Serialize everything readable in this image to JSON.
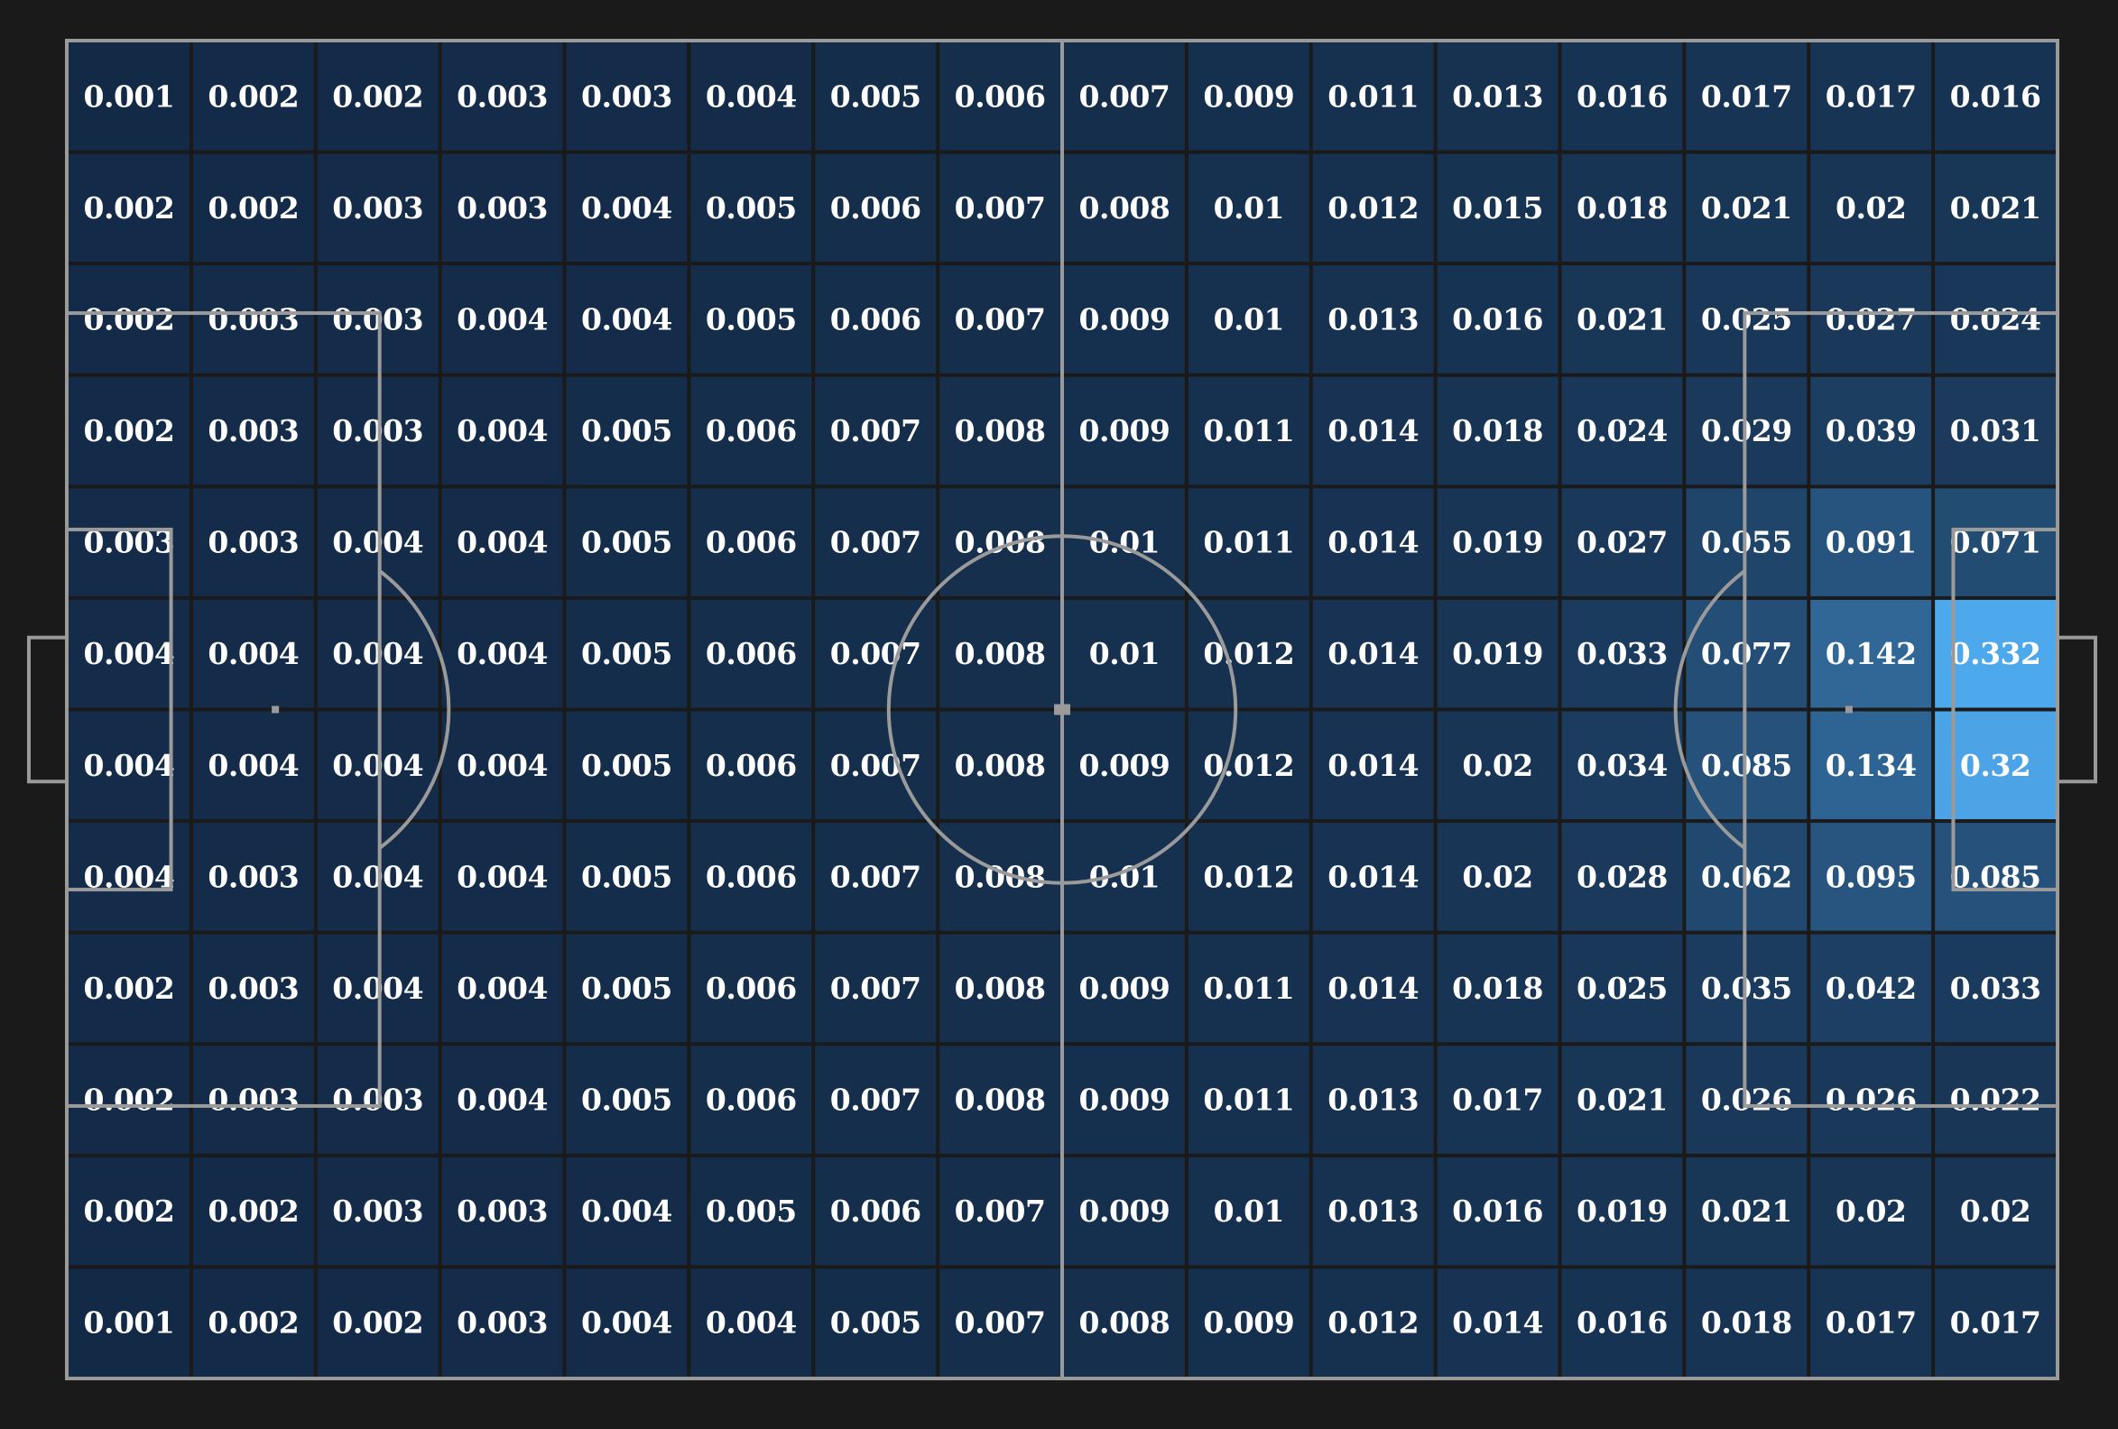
{
  "chart_data": {
    "type": "heatmap",
    "description_free": true,
    "rows": 12,
    "cols": 16,
    "value_range": [
      0.001,
      0.332
    ],
    "colors": {
      "background": "#1a1a1a",
      "cell_min": "#132a47",
      "cell_max": "#4ea8ec",
      "lines": "#9a9a9a",
      "text": "#ffffff"
    },
    "values": [
      [
        0.001,
        0.002,
        0.002,
        0.003,
        0.003,
        0.004,
        0.005,
        0.006,
        0.007,
        0.009,
        0.011,
        0.013,
        0.016,
        0.017,
        0.017,
        0.016
      ],
      [
        0.002,
        0.002,
        0.003,
        0.003,
        0.004,
        0.005,
        0.006,
        0.007,
        0.008,
        0.01,
        0.012,
        0.015,
        0.018,
        0.021,
        0.02,
        0.021
      ],
      [
        0.002,
        0.003,
        0.003,
        0.004,
        0.004,
        0.005,
        0.006,
        0.007,
        0.009,
        0.01,
        0.013,
        0.016,
        0.021,
        0.025,
        0.027,
        0.024
      ],
      [
        0.002,
        0.003,
        0.003,
        0.004,
        0.005,
        0.006,
        0.007,
        0.008,
        0.009,
        0.011,
        0.014,
        0.018,
        0.024,
        0.029,
        0.039,
        0.031
      ],
      [
        0.003,
        0.003,
        0.004,
        0.004,
        0.005,
        0.006,
        0.007,
        0.008,
        0.01,
        0.011,
        0.014,
        0.019,
        0.027,
        0.055,
        0.091,
        0.071
      ],
      [
        0.004,
        0.004,
        0.004,
        0.004,
        0.005,
        0.006,
        0.007,
        0.008,
        0.01,
        0.012,
        0.014,
        0.019,
        0.033,
        0.077,
        0.142,
        0.332
      ],
      [
        0.004,
        0.004,
        0.004,
        0.004,
        0.005,
        0.006,
        0.007,
        0.008,
        0.009,
        0.012,
        0.014,
        0.02,
        0.034,
        0.085,
        0.134,
        0.32
      ],
      [
        0.004,
        0.003,
        0.004,
        0.004,
        0.005,
        0.006,
        0.007,
        0.008,
        0.01,
        0.012,
        0.014,
        0.02,
        0.028,
        0.062,
        0.095,
        0.085
      ],
      [
        0.002,
        0.003,
        0.004,
        0.004,
        0.005,
        0.006,
        0.007,
        0.008,
        0.009,
        0.011,
        0.014,
        0.018,
        0.025,
        0.035,
        0.042,
        0.033
      ],
      [
        0.002,
        0.003,
        0.003,
        0.004,
        0.005,
        0.006,
        0.007,
        0.008,
        0.009,
        0.011,
        0.013,
        0.017,
        0.021,
        0.026,
        0.026,
        0.022
      ],
      [
        0.002,
        0.002,
        0.003,
        0.003,
        0.004,
        0.005,
        0.006,
        0.007,
        0.009,
        0.01,
        0.013,
        0.016,
        0.019,
        0.021,
        0.02,
        0.02
      ],
      [
        0.001,
        0.002,
        0.002,
        0.003,
        0.004,
        0.004,
        0.005,
        0.007,
        0.008,
        0.009,
        0.012,
        0.014,
        0.016,
        0.018,
        0.017,
        0.017
      ]
    ]
  }
}
